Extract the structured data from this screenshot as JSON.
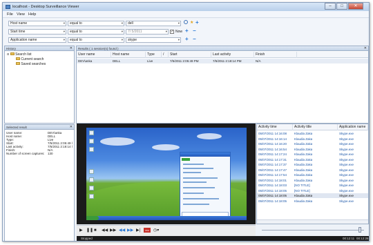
{
  "window": {
    "title": "localhost - Desktop Surveillance Viewer",
    "min": "–",
    "max": "□",
    "close": "✕"
  },
  "menu": [
    "File",
    "View",
    "Help"
  ],
  "filters": [
    {
      "field": "Host name",
      "op": "equal to",
      "value": "dell"
    },
    {
      "field": "Start time",
      "op": "equal to",
      "value": "7/ 5/2011",
      "now_label": "Now",
      "now_checked": true
    },
    {
      "field": "Application name",
      "op": "equal to",
      "value": "skype"
    }
  ],
  "history": {
    "title": "History",
    "root": "Search list",
    "items": [
      "Current search",
      "Saved searches"
    ]
  },
  "results": {
    "title": "Results ( 1 session(s) found )",
    "columns": [
      "User name",
      "Host name",
      "Type",
      "/",
      "Start",
      "Last activity",
      "Finish"
    ],
    "rows": [
      [
        "DEV\\anka",
        "DELL",
        "Live",
        "",
        "7/5/2011 2:05:49 PM",
        "7/5/2011 2:18:14 PM",
        "N/A"
      ]
    ]
  },
  "selected": {
    "title": "Selected result",
    "fields": [
      {
        "k": "User name:",
        "v": "DEV\\anka"
      },
      {
        "k": "Host name:",
        "v": "DELL"
      },
      {
        "k": "Type:",
        "v": "Live"
      },
      {
        "k": "Start:",
        "v": "7/5/2011 2:05:49 l"
      },
      {
        "k": "Last activity:",
        "v": "7/5/2011 2:18:14 l"
      },
      {
        "k": "Finish:",
        "v": "N/A"
      },
      {
        "k": "Number of screen captures:",
        "v": "130"
      }
    ]
  },
  "activity": {
    "columns": [
      "Activity time",
      "Activity title",
      "Application name"
    ],
    "rows": [
      [
        "05/07/2011 14:16:08",
        "Klaudia Zaka",
        "Skype.exe"
      ],
      [
        "05/07/2011 14:16:14",
        "Klaudia Zaka",
        "Skype.exe"
      ],
      [
        "05/07/2011 14:16:20",
        "Klaudia Zaka",
        "Skype.exe"
      ],
      [
        "05/07/2011 14:16:54",
        "Klaudia Zaka",
        "Skype.exe"
      ],
      [
        "05/07/2011 14:17:24",
        "Klaudia Zaka",
        "Skype.exe"
      ],
      [
        "05/07/2011 14:17:31",
        "Klaudia Zaka",
        "Skype.exe"
      ],
      [
        "05/07/2011 14:17:37",
        "Klaudia Zaka",
        "Skype.exe"
      ],
      [
        "05/07/2011 14:17:47",
        "Klaudia Zaka",
        "Skype.exe"
      ],
      [
        "05/07/2011 14:17:54",
        "Klaudia Zaka",
        "Skype.exe"
      ],
      [
        "05/07/2011 14:18:01",
        "Klaudia Zaka",
        "Skype.exe"
      ],
      [
        "05/07/2011 14:18:03",
        "[NO TITLE]",
        "Skype.exe"
      ],
      [
        "05/07/2011 14:18:05",
        "[NO TITLE]",
        "Skype.exe"
      ],
      [
        "05/07/2011 14:18:05",
        "Klaudia Zaka",
        "Skype.exe"
      ],
      [
        "05/07/2011 14:18:05",
        "Klaudia Zaka",
        "Skype.exe"
      ]
    ],
    "selected_index": 12
  },
  "player": {
    "status": "Stopped",
    "time_left": "00:12:11",
    "time_right": "00:12:26"
  }
}
